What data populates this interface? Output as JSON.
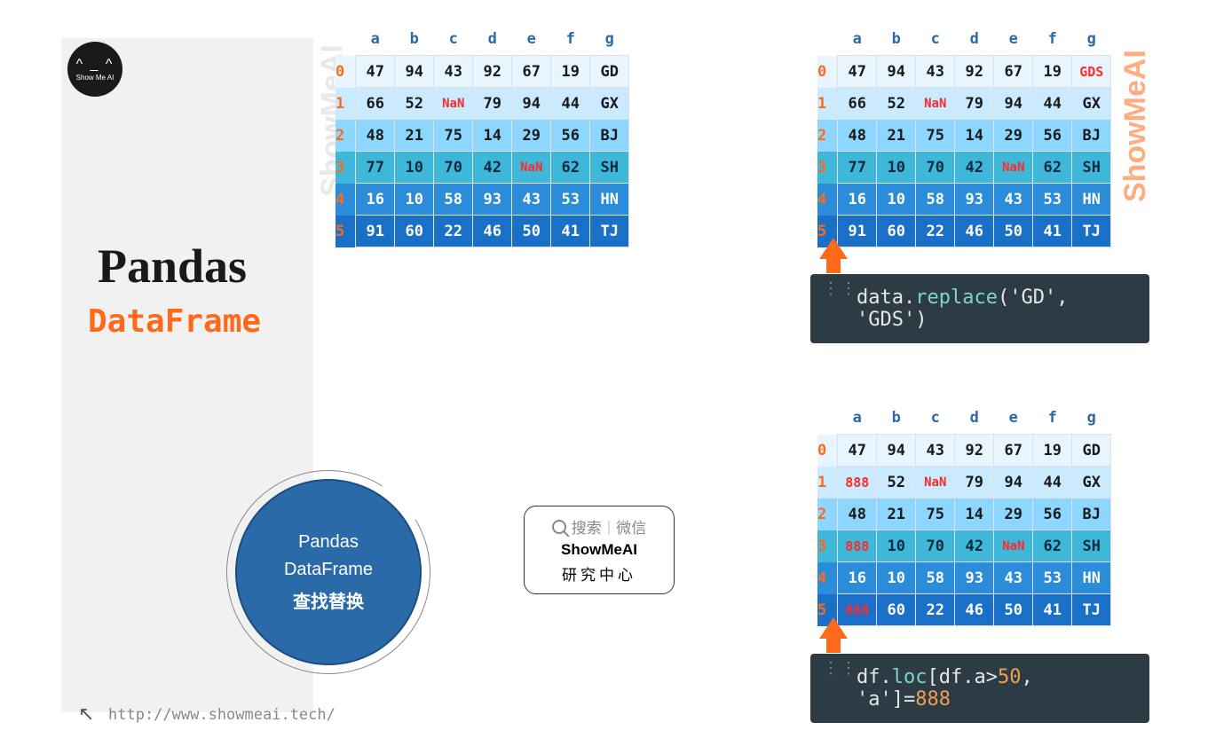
{
  "logo": {
    "face": "^ _ ^",
    "text": "Show Me AI"
  },
  "title": {
    "big": "Pandas",
    "sub": "DataFrame"
  },
  "watermarks": {
    "grey": "ShowMeAI",
    "orange": "ShowMeAI"
  },
  "circle": {
    "line1": "Pandas",
    "line2": "DataFrame",
    "line3": "查找替换"
  },
  "search": {
    "label": "搜索",
    "platform": "微信",
    "name": "ShowMeAI",
    "center": "研究中心"
  },
  "footer": {
    "url": "http://www.showmeai.tech/"
  },
  "table_columns": [
    "a",
    "b",
    "c",
    "d",
    "e",
    "f",
    "g"
  ],
  "table_index": [
    "0",
    "1",
    "2",
    "3",
    "4",
    "5"
  ],
  "table_left": {
    "rows": [
      {
        "a": "47",
        "b": "94",
        "c": "43",
        "d": "92",
        "e": "67",
        "f": "19",
        "g": "GD"
      },
      {
        "a": "66",
        "b": "52",
        "c": "NaN",
        "d": "79",
        "e": "94",
        "f": "44",
        "g": "GX"
      },
      {
        "a": "48",
        "b": "21",
        "c": "75",
        "d": "14",
        "e": "29",
        "f": "56",
        "g": "BJ"
      },
      {
        "a": "77",
        "b": "10",
        "c": "70",
        "d": "42",
        "e": "NaN",
        "f": "62",
        "g": "SH"
      },
      {
        "a": "16",
        "b": "10",
        "c": "58",
        "d": "93",
        "e": "43",
        "f": "53",
        "g": "HN"
      },
      {
        "a": "91",
        "b": "60",
        "c": "22",
        "d": "46",
        "e": "50",
        "f": "41",
        "g": "TJ"
      }
    ]
  },
  "table_top_right": {
    "rows": [
      {
        "a": "47",
        "b": "94",
        "c": "43",
        "d": "92",
        "e": "67",
        "f": "19",
        "g": "GDS"
      },
      {
        "a": "66",
        "b": "52",
        "c": "NaN",
        "d": "79",
        "e": "94",
        "f": "44",
        "g": "GX"
      },
      {
        "a": "48",
        "b": "21",
        "c": "75",
        "d": "14",
        "e": "29",
        "f": "56",
        "g": "BJ"
      },
      {
        "a": "77",
        "b": "10",
        "c": "70",
        "d": "42",
        "e": "NaN",
        "f": "62",
        "g": "SH"
      },
      {
        "a": "16",
        "b": "10",
        "c": "58",
        "d": "93",
        "e": "43",
        "f": "53",
        "g": "HN"
      },
      {
        "a": "91",
        "b": "60",
        "c": "22",
        "d": "46",
        "e": "50",
        "f": "41",
        "g": "TJ"
      }
    ],
    "highlight": [
      [
        0,
        "g"
      ]
    ]
  },
  "table_bottom_right": {
    "rows": [
      {
        "a": "47",
        "b": "94",
        "c": "43",
        "d": "92",
        "e": "67",
        "f": "19",
        "g": "GD"
      },
      {
        "a": "888",
        "b": "52",
        "c": "NaN",
        "d": "79",
        "e": "94",
        "f": "44",
        "g": "GX"
      },
      {
        "a": "48",
        "b": "21",
        "c": "75",
        "d": "14",
        "e": "29",
        "f": "56",
        "g": "BJ"
      },
      {
        "a": "888",
        "b": "10",
        "c": "70",
        "d": "42",
        "e": "NaN",
        "f": "62",
        "g": "SH"
      },
      {
        "a": "16",
        "b": "10",
        "c": "58",
        "d": "93",
        "e": "43",
        "f": "53",
        "g": "HN"
      },
      {
        "a": "888",
        "b": "60",
        "c": "22",
        "d": "46",
        "e": "50",
        "f": "41",
        "g": "TJ"
      }
    ],
    "highlight": [
      [
        1,
        "a"
      ],
      [
        3,
        "a"
      ],
      [
        5,
        "a"
      ]
    ]
  },
  "code1": {
    "obj": "data",
    "method": "replace",
    "arg1": "'GD'",
    "sep": ", ",
    "arg2": "'GDS'"
  },
  "code2": {
    "obj": "df",
    "method": "loc",
    "expr": "[df.a",
    "op": ">",
    "num": "50",
    "rest": ", 'a']=",
    "val": "888"
  }
}
